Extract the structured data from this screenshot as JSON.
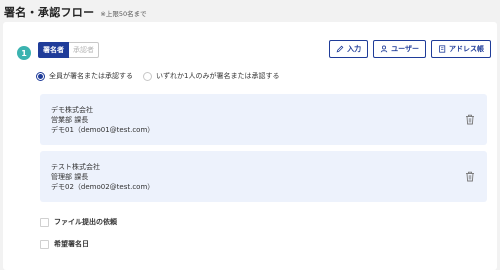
{
  "header": {
    "title": "署名・承認フロー",
    "note": "※上限50名まで"
  },
  "flow": {
    "step_number": "1",
    "tabs": [
      {
        "label": "署名者",
        "active": true
      },
      {
        "label": "承認者",
        "active": false
      }
    ],
    "actions": {
      "input_label": "入力",
      "user_label": "ユーザー",
      "address_label": "アドレス帳"
    },
    "radio_options": [
      {
        "label": "全員が署名または承認する",
        "checked": true
      },
      {
        "label": "いずれか1人のみが署名または承認する",
        "checked": false
      }
    ],
    "signers": [
      {
        "company": "デモ株式会社",
        "dept": "営業部 課長",
        "name_email": "デモ01（demo01@test.com）"
      },
      {
        "company": "テスト株式会社",
        "dept": "管理部 課長",
        "name_email": "デモ02（demo02@test.com）"
      }
    ],
    "options": {
      "file_request_label": "ファイル提出の依頼",
      "desired_date_label": "希望署名日"
    }
  },
  "colors": {
    "primary": "#1f3c99",
    "step_badge": "#3bb3b0",
    "signer_bg": "#edf2fc",
    "page_bg": "#f2f2f2"
  }
}
